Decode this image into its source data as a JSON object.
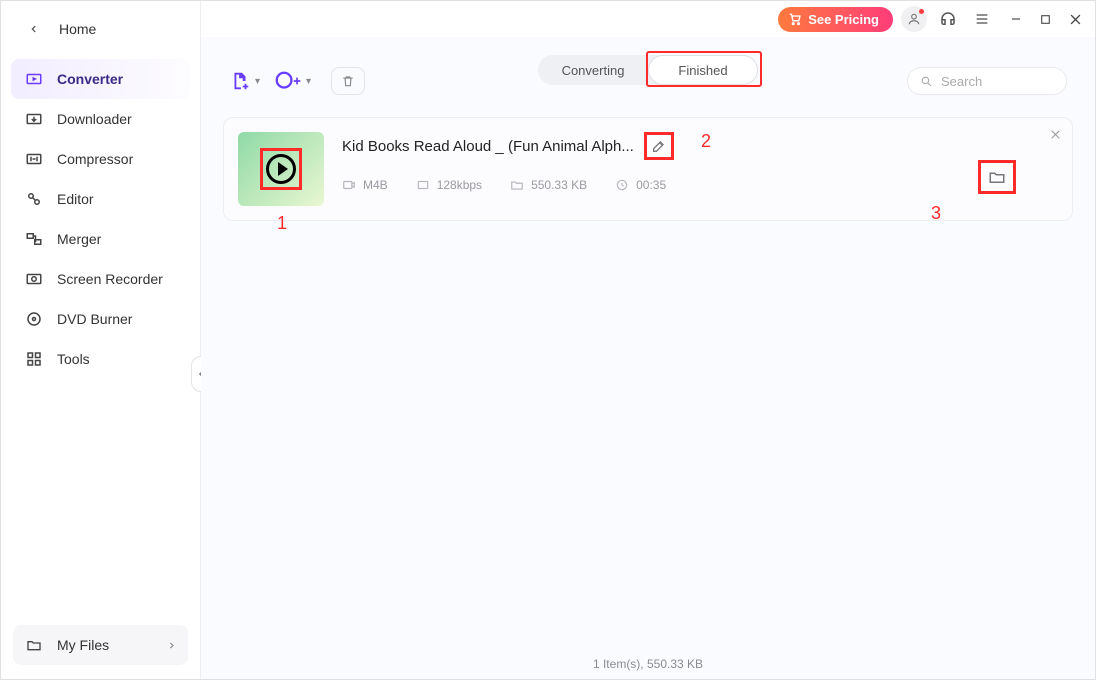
{
  "topbar": {
    "pricing_label": "See Pricing"
  },
  "sidebar": {
    "home_label": "Home",
    "items": [
      {
        "label": "Converter"
      },
      {
        "label": "Downloader"
      },
      {
        "label": "Compressor"
      },
      {
        "label": "Editor"
      },
      {
        "label": "Merger"
      },
      {
        "label": "Screen Recorder"
      },
      {
        "label": "DVD Burner"
      },
      {
        "label": "Tools"
      }
    ],
    "myfiles_label": "My Files"
  },
  "tabs": {
    "converting": "Converting",
    "finished": "Finished"
  },
  "search": {
    "placeholder": "Search"
  },
  "item": {
    "title": "Kid Books Read Aloud _ (Fun Animal Alph...",
    "format": "M4B",
    "bitrate": "128kbps",
    "size": "550.33 KB",
    "duration": "00:35"
  },
  "annotations": {
    "a1": "1",
    "a2": "2",
    "a3": "3"
  },
  "footer": {
    "summary": "1 Item(s), 550.33 KB"
  }
}
